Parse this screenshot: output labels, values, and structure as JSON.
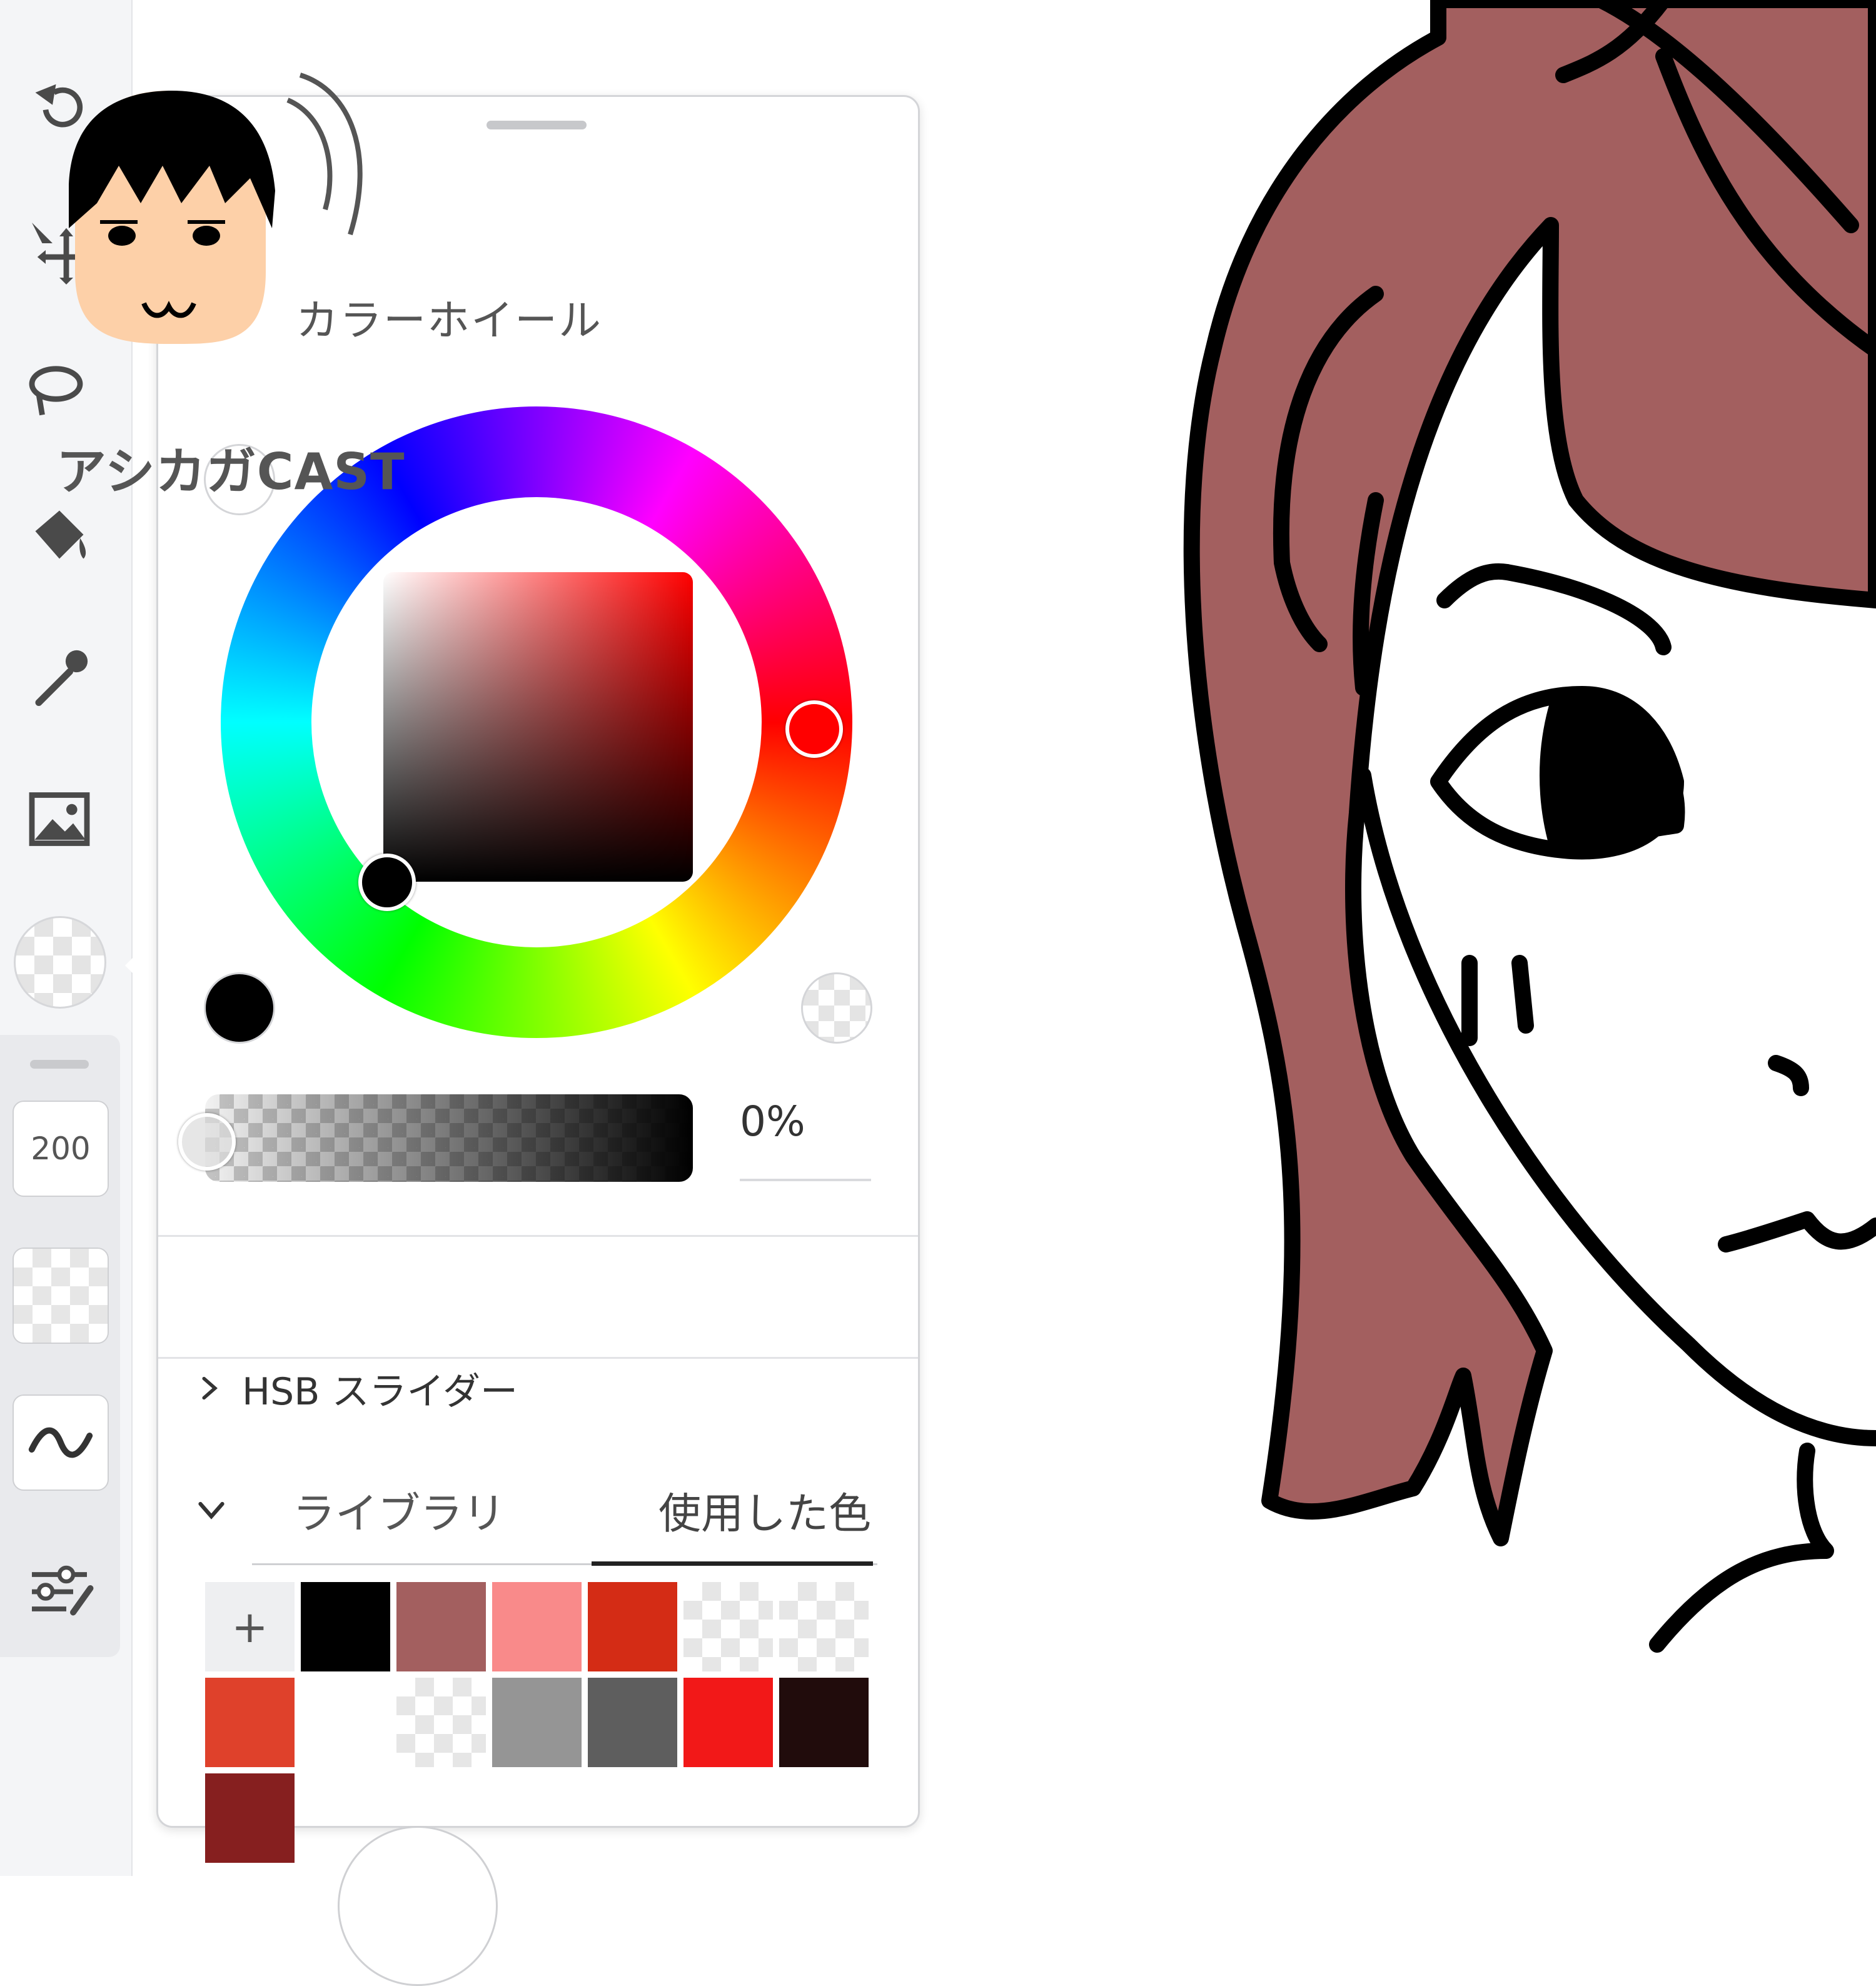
{
  "app": {
    "size_label": "200"
  },
  "watermark": {
    "text": "アシカガCAST"
  },
  "color_panel": {
    "title": "カラーホイール",
    "opacity_value": "0%",
    "hsb_label": "HSB スライダー",
    "tabs": [
      {
        "label": "ライブラリ",
        "active": false
      },
      {
        "label": "使用した色",
        "active": true
      }
    ],
    "add_swatch_label": "+",
    "swatches": [
      {
        "color": "#000000"
      },
      {
        "color": "#a35f5f"
      },
      {
        "color": "#f98a8a"
      },
      {
        "color": "#d42c15"
      },
      {
        "color": "transparent"
      },
      {
        "color": "transparent"
      },
      {
        "color": "#df412b"
      },
      {
        "color": "#ffffff"
      },
      {
        "color": "transparent"
      },
      {
        "color": "#959595"
      },
      {
        "color": "#5e5e5e"
      },
      {
        "color": "#f21818"
      },
      {
        "color": "#210c0c"
      },
      {
        "color": "#861f1f"
      }
    ],
    "hue_marker_color": "#ff0000",
    "current_color": "#000000"
  },
  "icons": [
    "undo-icon",
    "move-icon",
    "lasso-icon",
    "fill-bucket-icon",
    "eyedropper-icon",
    "image-icon",
    "color-swatch-icon",
    "wave-stroke-icon",
    "adjustments-icon"
  ],
  "drawing": {
    "hair_color": "#a35f5f",
    "line_color": "#000000"
  }
}
